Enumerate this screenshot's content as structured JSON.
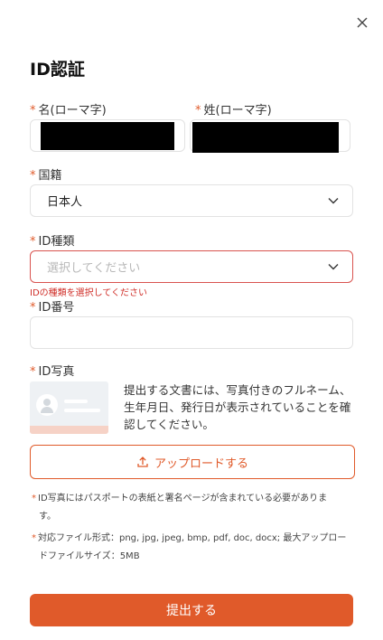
{
  "dialog": {
    "title": "ID認証",
    "close_icon": "close-icon"
  },
  "form": {
    "required_mark": "*",
    "first_name": {
      "label": "名(ローマ字)",
      "value_redacted": true
    },
    "last_name": {
      "label": "姓(ローマ字)",
      "value_redacted": true
    },
    "nationality": {
      "label": "国籍",
      "value": "日本人",
      "icon": "chevron-down-icon"
    },
    "id_type": {
      "label": "ID種類",
      "placeholder": "選択してください",
      "icon": "chevron-down-icon",
      "error": "IDの種類を選択してください"
    },
    "id_number": {
      "label": "ID番号",
      "value": ""
    },
    "id_photo": {
      "label": "ID写真",
      "description": "提出する文書には、写真付きのフルネーム、生年月日、発行日が表示されていることを確認してください。",
      "upload_label": "アップロードする",
      "upload_icon": "upload-icon"
    }
  },
  "notes": [
    {
      "line1": "ID写真にはパスポートの表紙と署名ページが含まれている必要がありま",
      "line2": "す。"
    },
    {
      "line1": "対応ファイル形式：png, jpg, jpeg, bmp, pdf, doc, docx; 最大アップロー",
      "line2": "ドファイルサイズ：5MB"
    }
  ],
  "submit": {
    "label": "提出する"
  },
  "colors": {
    "accent": "#e05a2a",
    "error": "#d0302a",
    "border": "#e2e2e2"
  }
}
